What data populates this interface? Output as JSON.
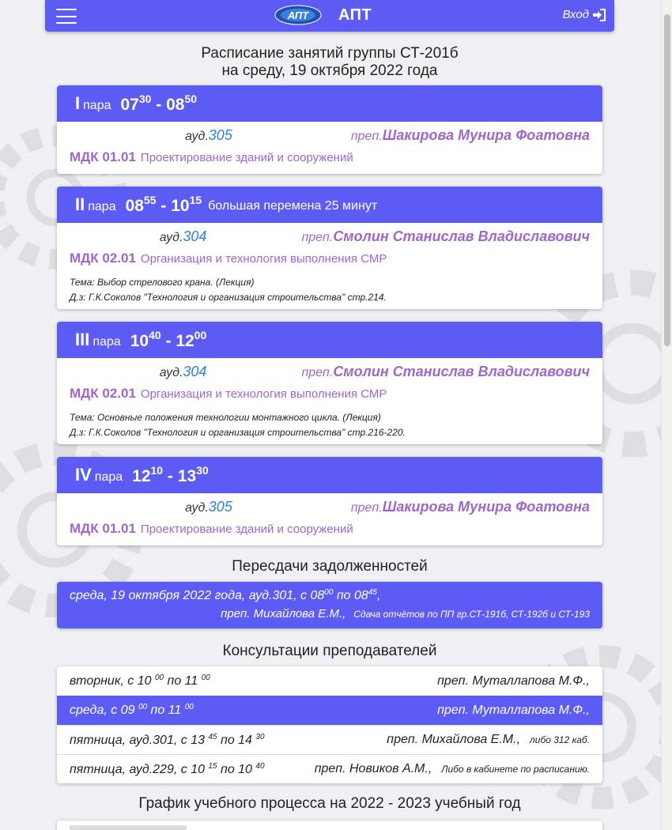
{
  "nav": {
    "brand": "АПТ",
    "login": "Вход",
    "logo_text": "АПТ"
  },
  "heading": {
    "line1": "Расписание занятий группы СТ-201б",
    "line2": "на среду, 19 октября 2022 года"
  },
  "lessons": [
    {
      "roman": "I",
      "para": "пара",
      "start_h": "07",
      "start_m": "30",
      "end_h": "08",
      "end_m": "50",
      "note": "",
      "aud_label": "ауд.",
      "aud": "305",
      "prep_label": "преп.",
      "teacher": "Шакирова Мунира Фоатовна",
      "mdk_code": "МДК 01.01",
      "mdk_name": "Проектирование зданий и сооружений",
      "topic": "",
      "homework": ""
    },
    {
      "roman": "II",
      "para": "пара",
      "start_h": "08",
      "start_m": "55",
      "end_h": "10",
      "end_m": "15",
      "note": "большая перемена 25 минут",
      "aud_label": "ауд.",
      "aud": "304",
      "prep_label": "преп.",
      "teacher": "Смолин Станислав Владиславович",
      "mdk_code": "МДК 02.01",
      "mdk_name": "Организация и технология выполнения СМР",
      "topic": "Тема: Выбор стрелового крана. (Лекция)",
      "homework": "Д.з: Г.К.Соколов \"Технология и организация строительства\" стр.214."
    },
    {
      "roman": "III",
      "para": "пара",
      "start_h": "10",
      "start_m": "40",
      "end_h": "12",
      "end_m": "00",
      "note": "",
      "aud_label": "ауд.",
      "aud": "304",
      "prep_label": "преп.",
      "teacher": "Смолин Станислав Владиславович",
      "mdk_code": "МДК 02.01",
      "mdk_name": "Организация и технология выполнения СМР",
      "topic": "Тема: Основные положения технологии монтажного цикла. (Лекция)",
      "homework": "Д.з: Г.К.Соколов \"Технология и организация строительства\" стр.216-220."
    },
    {
      "roman": "IV",
      "para": "пара",
      "start_h": "12",
      "start_m": "10",
      "end_h": "13",
      "end_m": "30",
      "note": "",
      "aud_label": "ауд.",
      "aud": "305",
      "prep_label": "преп.",
      "teacher": "Шакирова Мунира Фоатовна",
      "mdk_code": "МДК 01.01",
      "mdk_name": "Проектирование зданий и сооружений",
      "topic": "",
      "homework": ""
    }
  ],
  "retakes": {
    "title": "Пересдачи задолженностей",
    "line1_prefix": "среда, 19 октября 2022 года,  ауд.301,  с 08",
    "from_min": "00",
    "mid": " по 08",
    "to_min": "45",
    "line1_suffix": ",",
    "teacher": "преп. Михайлова Е.М.,",
    "note": "Сдача отчётов по ПП гр.СТ-191б, СТ-192б и СТ-193"
  },
  "consultations": {
    "title": "Консультации преподавателей",
    "rows": [
      {
        "left_a": "вторник,  с 10 ",
        "sup1": "00",
        "left_b": " по 11 ",
        "sup2": "00",
        "teacher": "преп. Муталлапова М.Ф.,",
        "note": "",
        "highlight": false
      },
      {
        "left_a": "среда,  с 09 ",
        "sup1": "00",
        "left_b": " по 11 ",
        "sup2": "00",
        "teacher": "преп. Муталлапова М.Ф.,",
        "note": "",
        "highlight": true
      },
      {
        "left_a": "пятница,  ауд.301,  с 13 ",
        "sup1": "45",
        "left_b": " по 14 ",
        "sup2": "30",
        "teacher": "преп. Михайлова Е.М.,",
        "note": "либо 312 каб.",
        "highlight": false
      },
      {
        "left_a": "пятница,  ауд.229,  с 10 ",
        "sup1": "15",
        "left_b": " по 10 ",
        "sup2": "40",
        "teacher": "преп. Новиков А.М.,",
        "note": "Либо в кабинете по расписанию.",
        "highlight": false
      }
    ]
  },
  "schedule_title": "График учебного процесса на 2022 - 2023 учебный год",
  "colors": {
    "accent": "#5c5cf5",
    "purple_text": "#a066c8",
    "room_blue": "#2d7fdb"
  }
}
